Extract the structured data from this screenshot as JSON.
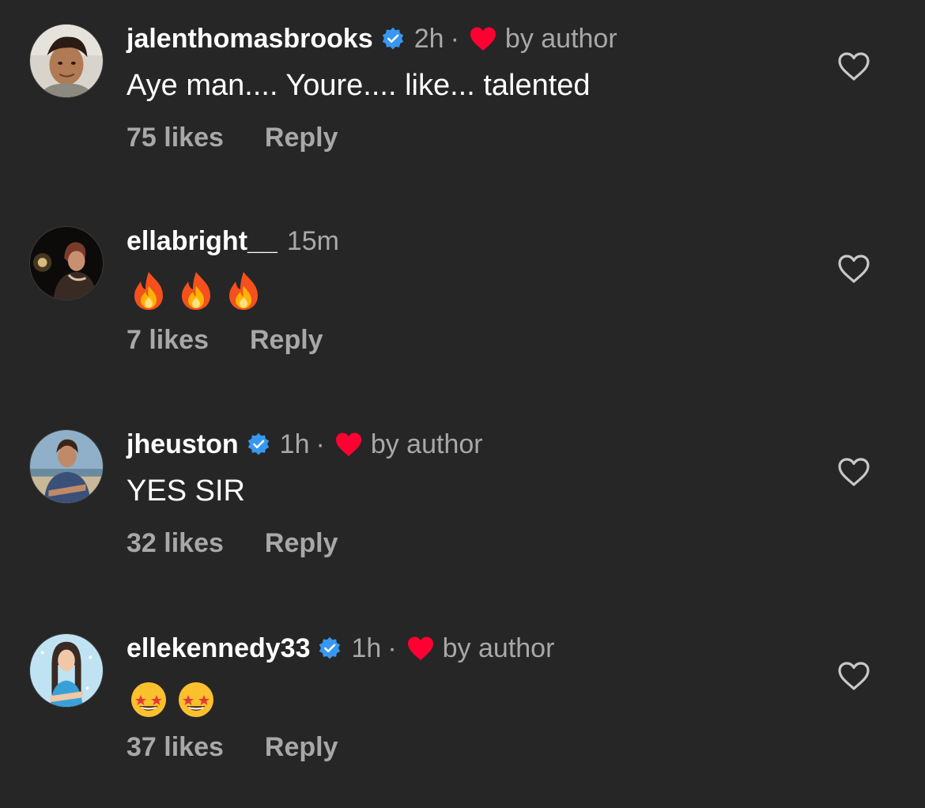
{
  "comments": [
    {
      "username": "jalenthomasbrooks",
      "verified": true,
      "time": "2h",
      "author_liked": true,
      "author_label": "by author",
      "text": "Aye man.... Youre.... like... talented",
      "emojis": [],
      "likes": "75 likes",
      "reply": "Reply"
    },
    {
      "username": "ellabright__",
      "verified": false,
      "time": "15m",
      "author_liked": false,
      "author_label": "",
      "text": "",
      "emojis": [
        "fire",
        "fire",
        "fire"
      ],
      "likes": "7 likes",
      "reply": "Reply"
    },
    {
      "username": "jheuston",
      "verified": true,
      "time": "1h",
      "author_liked": true,
      "author_label": "by author",
      "text": "YES SIR",
      "emojis": [],
      "likes": "32 likes",
      "reply": "Reply"
    },
    {
      "username": "ellekennedy33",
      "verified": true,
      "time": "1h",
      "author_liked": true,
      "author_label": "by author",
      "text": "",
      "emojis": [
        "star-struck",
        "star-struck"
      ],
      "likes": "37 likes",
      "reply": "Reply"
    }
  ],
  "separator": "·",
  "colors": {
    "background": "#262626",
    "primary_text": "#ffffff",
    "secondary_text": "#a8a8a8",
    "verified_blue": "#3897f0",
    "heart_red": "#ff0033"
  }
}
